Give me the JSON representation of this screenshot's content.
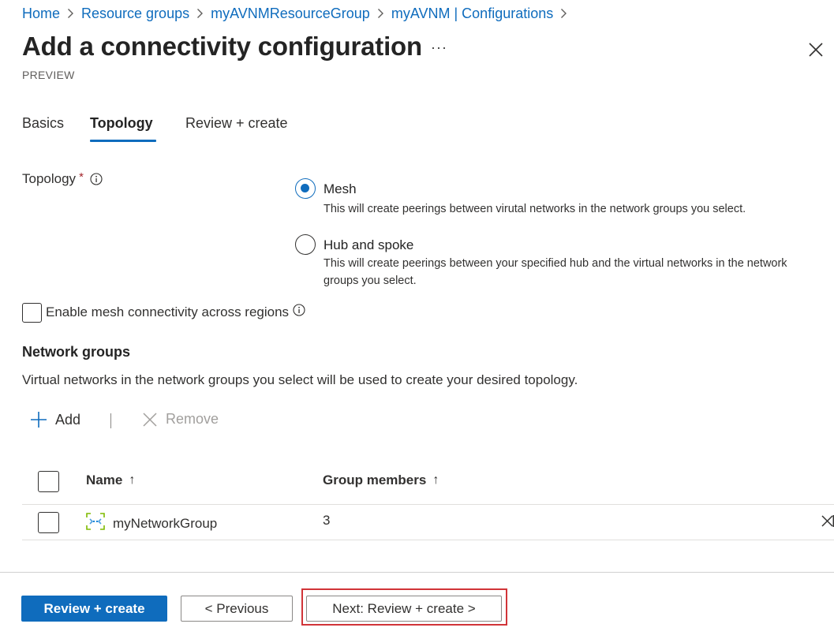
{
  "breadcrumb": [
    "Home",
    "Resource groups",
    "myAVNMResourceGroup",
    "myAVNM | Configurations"
  ],
  "title": "Add a connectivity configuration",
  "more_label": "···",
  "preview_label": "PREVIEW",
  "tabs": [
    {
      "label": "Basics",
      "active": false
    },
    {
      "label": "Topology",
      "active": true
    },
    {
      "label": "Review + create",
      "active": false
    }
  ],
  "topology": {
    "label": "Topology",
    "required_mark": "*",
    "options": [
      {
        "label": "Mesh",
        "description": "This will create peerings between virutal networks in the network groups you select.",
        "selected": true
      },
      {
        "label": "Hub and spoke",
        "description": "This will create peerings between your specified hub and the virtual networks in the network groups you select.",
        "selected": false
      }
    ]
  },
  "mesh_checkbox": {
    "label": "Enable mesh connectivity across regions",
    "checked": false
  },
  "network_groups": {
    "heading": "Network groups",
    "description": "Virtual networks in the network groups you select will be used to create your desired topology.",
    "add_label": "Add",
    "remove_label": "Remove",
    "columns": [
      {
        "label": "Name",
        "sort": "↑"
      },
      {
        "label": "Group members",
        "sort": "↑"
      }
    ],
    "rows": [
      {
        "name": "myNetworkGroup",
        "members": "3"
      }
    ]
  },
  "footer": {
    "review_create": "Review + create",
    "previous": "< Previous",
    "next": "Next: Review + create >"
  },
  "colors": {
    "accent": "#0f6cbd",
    "highlight": "#d13438"
  }
}
